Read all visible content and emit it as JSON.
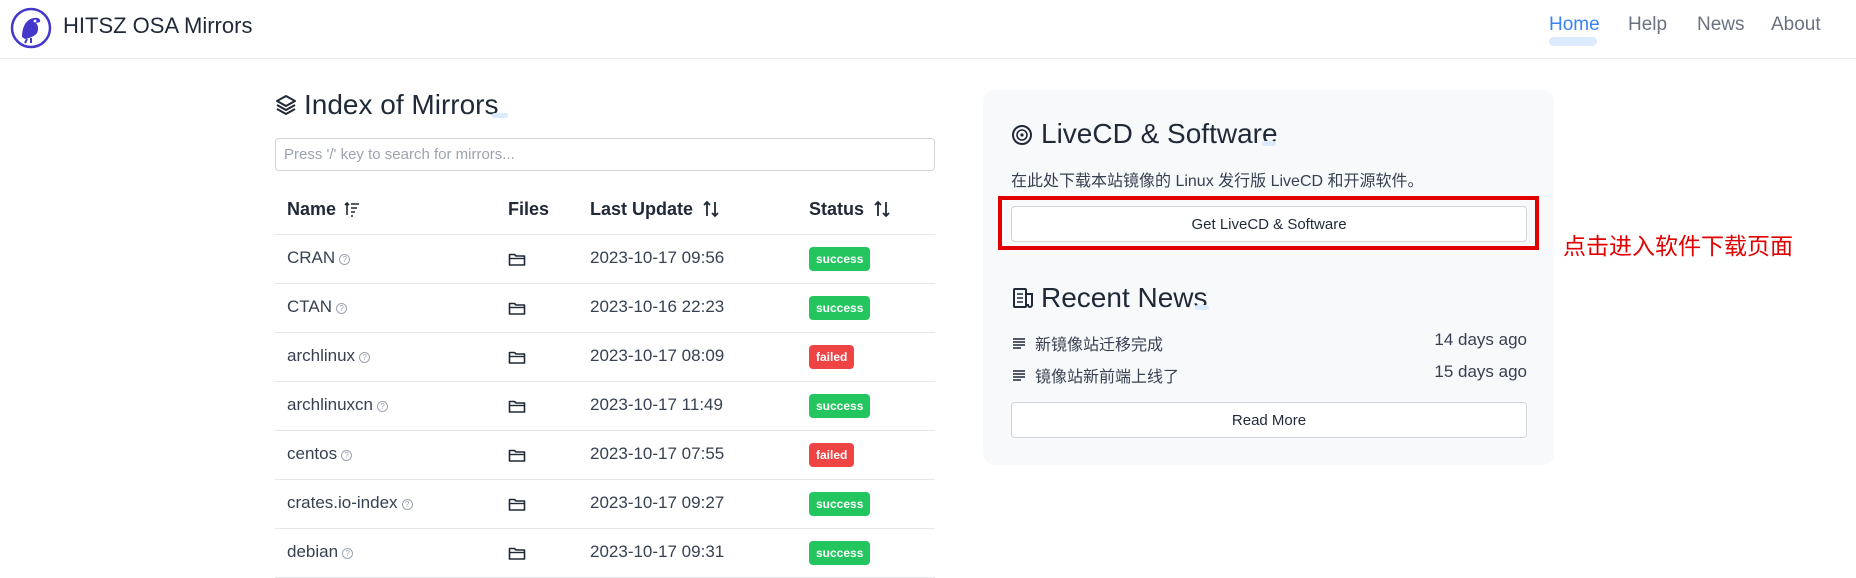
{
  "header": {
    "brand": "HITSZ OSA Mirrors",
    "nav": [
      "Home",
      "Help",
      "News",
      "About"
    ],
    "active_nav": "Home"
  },
  "mirrors": {
    "title": "Index of Mirrors",
    "search_placeholder": "Press '/' key to search for mirrors...",
    "columns": [
      "Name",
      "Files",
      "Last Update",
      "Status"
    ],
    "rows": [
      {
        "name": "CRAN",
        "updated": "2023-10-17 09:56",
        "status": "success"
      },
      {
        "name": "CTAN",
        "updated": "2023-10-16 22:23",
        "status": "success"
      },
      {
        "name": "archlinux",
        "updated": "2023-10-17 08:09",
        "status": "failed"
      },
      {
        "name": "archlinuxcn",
        "updated": "2023-10-17 11:49",
        "status": "success"
      },
      {
        "name": "centos",
        "updated": "2023-10-17 07:55",
        "status": "failed"
      },
      {
        "name": "crates.io-index",
        "updated": "2023-10-17 09:27",
        "status": "success"
      },
      {
        "name": "debian",
        "updated": "2023-10-17 09:31",
        "status": "success"
      }
    ]
  },
  "livecd": {
    "title": "LiveCD & Software",
    "description": "在此处下载本站镜像的 Linux 发行版 LiveCD 和开源软件。",
    "button": "Get LiveCD & Software"
  },
  "news": {
    "title": "Recent News",
    "items": [
      {
        "title": "新镜像站迁移完成",
        "time": "14 days ago"
      },
      {
        "title": "镜像站新前端上线了",
        "time": "15 days ago"
      }
    ],
    "read_more": "Read More"
  },
  "annotation": "点击进入软件下载页面",
  "colors": {
    "accent": "#3b82f6",
    "success": "#22c55e",
    "failed": "#ef4444",
    "annotation": "#e00000"
  }
}
